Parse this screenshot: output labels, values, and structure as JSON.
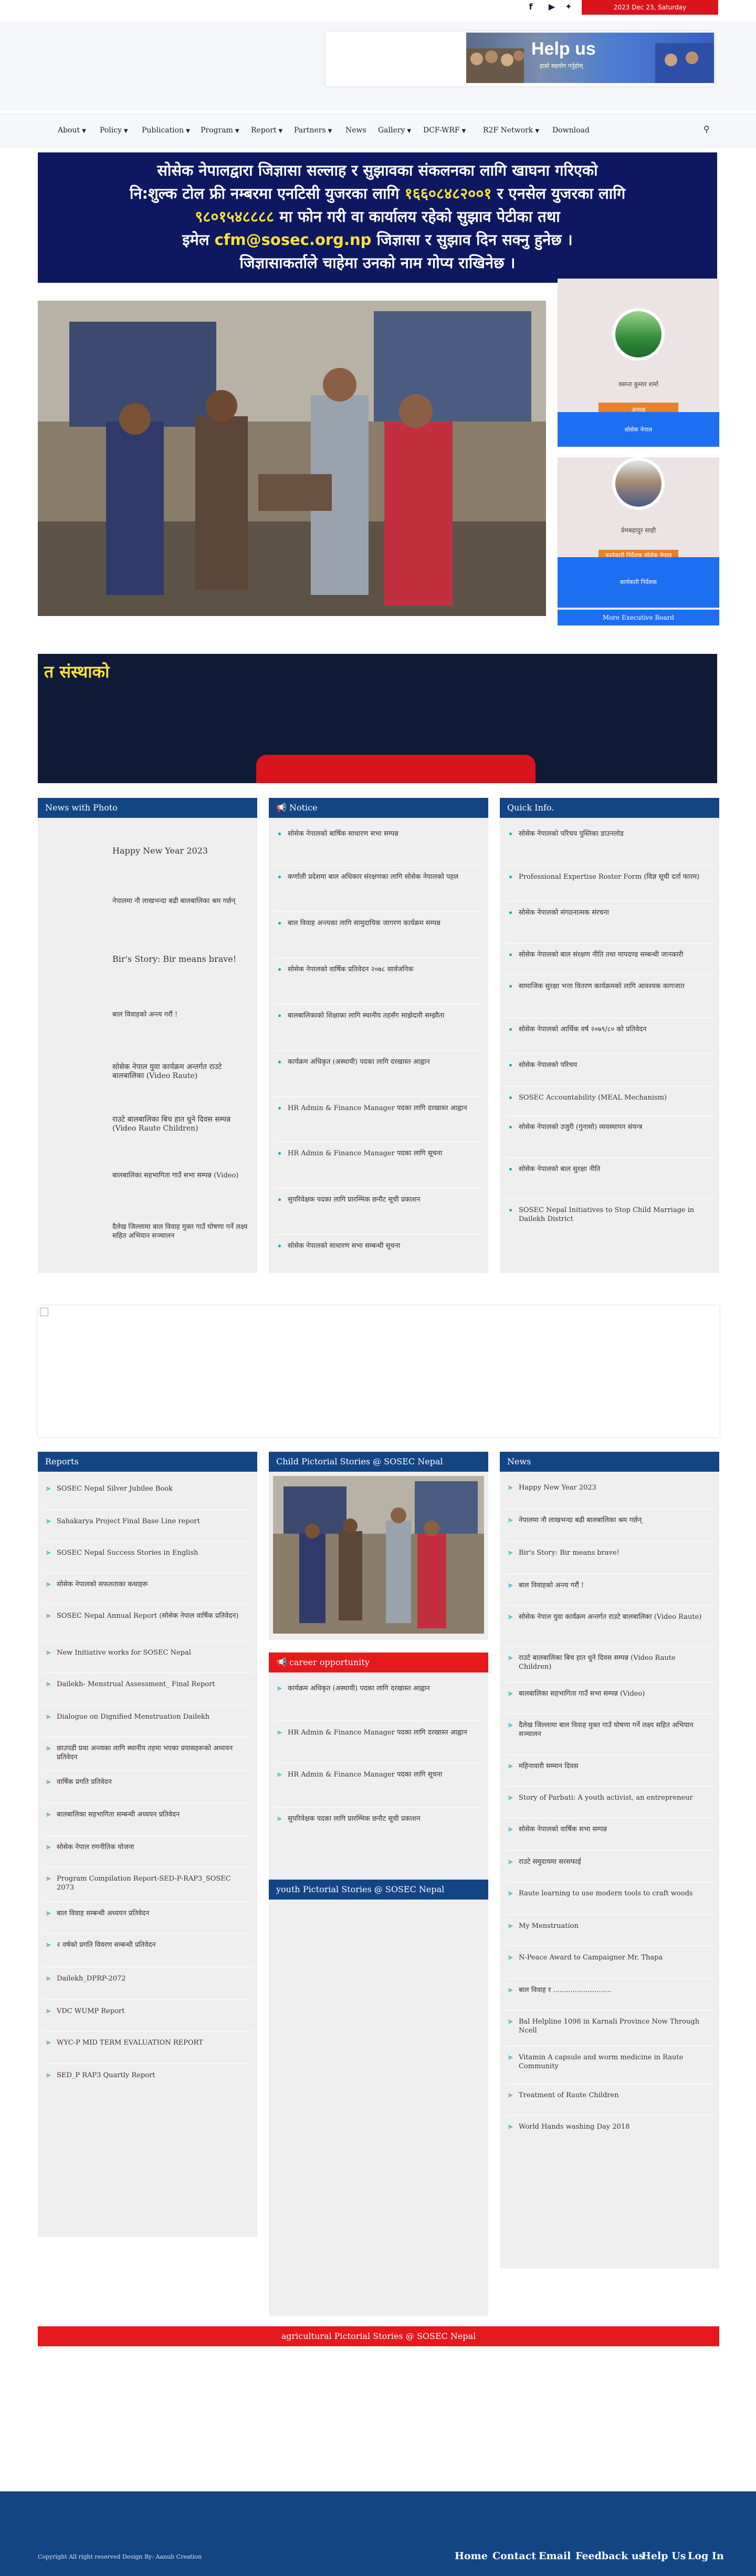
{
  "topbar": {
    "date": "2023 Dec 23, Saturday",
    "icons": [
      "facebook-icon",
      "youtube-icon",
      "twitter-icon"
    ]
  },
  "help_banner": {
    "title": "Help us",
    "subtitle": "हाम्रो सहयोग गर्नुहोस्"
  },
  "nav": {
    "items": [
      {
        "label": "About",
        "dropdown": true
      },
      {
        "label": "Policy",
        "dropdown": true
      },
      {
        "label": "Publication",
        "dropdown": true
      },
      {
        "label": "Program",
        "dropdown": true
      },
      {
        "label": "Report",
        "dropdown": true
      },
      {
        "label": "Partners",
        "dropdown": true
      },
      {
        "label": "News",
        "dropdown": false
      },
      {
        "label": "Gallery",
        "dropdown": true
      },
      {
        "label": "DCF-WRF",
        "dropdown": true
      },
      {
        "label": "R2F Network",
        "dropdown": true
      },
      {
        "label": "Download",
        "dropdown": false
      }
    ]
  },
  "notice_banner": {
    "line1": "सोसेक नेपालद्वारा जिज्ञासा सल्लाह र सुझावका संकलनका लागि खाघना गरिएको",
    "line2a": "नि:शुल्क टोल फ्री नम्बरमा एनटिसी युजरका लागि",
    "line2b": "१६६०८४८२००१",
    "line2c": "र एनसेल युजरका लागि",
    "line3a": "९८०१५४८८८८",
    "line3b": "मा फोन गरी वा कार्यालय रहेको सुझाव पेटीका तथा",
    "line4a": "इमेल",
    "line4b": "cfm@sosec.org.np",
    "line4c": "जिज्ञासा र सुझाव दिन सक्नु हुनेछ ।",
    "line5": "जिज्ञासाकर्ताले चाहेमा उनको नाम गोप्य राखिनेछ ।"
  },
  "executives": [
    {
      "name": "वसन्त कुमार शर्मा",
      "role": "अध्यक्ष",
      "bar": "सोसेक नेपाल"
    },
    {
      "name": "प्रेमबहादुर साही",
      "role": "कार्यकारी निर्देशक सोसेक नेपाल",
      "bar": "कार्यकारी निर्देशक"
    }
  ],
  "more_board": "More Executive Board",
  "dark_slider": {
    "title": "त संस्थाको"
  },
  "news_photo": {
    "title": "News with Photo",
    "items": [
      "Happy New Year 2023",
      "नेपालमा नौ लाखभन्दा बढी बालबालिका श्रम गर्छन्",
      "Bir's Story: Bir means brave!",
      "बाल विवाहको अन्त्य गरौं !",
      "सोसेक नेपाल युवा कार्यक्रम अन्तर्गत राउटे बालबालिका (Video Raute)",
      "राउटे बालबालिका बिच हात धुने दिवस सम्पन्न (Video Raute Children)",
      "बालबालिका सहभागिता गाउँ सभा सम्पन्न (Video)",
      "दैलेख जिल्लामा बाल विवाह मुक्त गाउँ घोषणा गर्ने लक्ष्य सहित अभियान सञ्चालन"
    ]
  },
  "notice": {
    "title": "Notice",
    "items": [
      "सोसेक नेपालको बार्षिक साधारण सभा सम्पन्न",
      "कर्णाली प्रदेशमा बाल अधिकार संरक्षणका लागि सोसेक नेपालको पहल",
      "बाल विवाह अन्त्यका लागि सामुदायिक जागरण कार्यक्रम सम्पन्न",
      "सोसेक नेपालको वार्षिक प्रतिवेदन २०७८ सार्वजनिक",
      "बालबालिकाको शिक्षाका लागि स्थानीय तहसँग साझेदारी सम्झौता",
      "कार्यक्रम अधिकृत (अस्थायी) पदका लागि दरखास्त आह्वान",
      "HR Admin & Finance Manager पदका लागि दरखास्त आह्वान",
      "HR Admin & Finance Manager पदका लागि सूचना",
      "सुपरिवेक्षक पदका लागि प्रारम्भिक छनौट सूची प्रकाशन",
      "सोसेक नेपालको साधारण सभा सम्बन्धी सूचना"
    ]
  },
  "quick_info": {
    "title": "Quick Info.",
    "items": [
      "सोसेक नेपालको परिचय पुस्तिका डाउनलोड",
      "Professional Expertise Roster Form (विज्ञ सूची दर्ता फारम)",
      "सोसेक नेपालको संगठनात्मक संरचना",
      "सोसेक नेपालको बाल संरक्षण नीति तथा मापदण्ड सम्बन्धी जानकारी",
      "सामाजिक सुरक्षा भत्ता वितरण कार्यक्रमको लागि आवश्यक कागजात",
      "सोसेक नेपालको आर्थिक वर्ष २०७९/८० को प्रतिवेदन",
      "सोसेक नेपालको परिचय",
      "SOSEC Accountability (MEAL Mechanism)",
      "सोसेक नेपालको उजुरी (गुनासो) व्यवस्थापन संयन्त्र",
      "सोसेक नेपालको बाल सुरक्षा नीति",
      "SOSEC Nepal Initiatives to Stop Child Marriage in Dailekh District"
    ]
  },
  "reports": {
    "title": "Reports",
    "items": [
      "SOSEC Nepal Silver Jubilee Book",
      "Sahakarya Project Final Base Line report",
      "SOSEC Nepal Success Stories in English",
      "सोसेक नेपालको सफलताका कथाहरू",
      "SOSEC Nepal Annual Report (सोसेक नेपाल वार्षिक प्रतिवेदन)",
      "New Initiative works for SOSEC Nepal",
      "Dailekh- Menstrual Assessment_ Final Report",
      "Dialogue on Dignified Menstruation Dailekh",
      "छाउपडी प्रथा अन्त्यका लागि स्थानीय तहमा भएका प्रयासहरूको अध्ययन प्रतिवेदन",
      "वार्षिक प्रगति प्रतिवेदन",
      "बालबालिका सहभागिता सम्बन्धी अध्ययन प्रतिवेदन",
      "सोसेक नेपाल रणनीतिक योजना",
      "Program Compilation Report-SED-P-RAP3_SOSEC 2073",
      "बाल विवाह सम्बन्धी अध्ययन प्रतिवेदन",
      "२ वर्षको प्रगति विवरण सम्बन्धी प्रतिवेदन",
      "Dailekh_DPRP-2072",
      "VDC WUMP Report",
      "WYC-P MID TERM EVALUATION REPORT",
      "SED_P RAP3 Quartly Report"
    ]
  },
  "child_stories": {
    "title": "Child Pictorial Stories @ SOSEC Nepal"
  },
  "career": {
    "title": "career opportunity",
    "items": [
      "कार्यक्रम अधिकृत (अस्थायी) पदका लागि दरखास्त आह्वान",
      "HR Admin & Finance Manager पदका लागि दरखास्त आह्वान",
      "HR Admin & Finance Manager पदका लागि सूचना",
      "सुपरिवेक्षक पदका लागि प्रारम्भिक छनौट सूची प्रकाशन"
    ]
  },
  "youth_stories": {
    "title": "youth Pictorial Stories @ SOSEC Nepal"
  },
  "news": {
    "title": "News",
    "items": [
      "Happy New Year 2023",
      "नेपालमा नौ लाखभन्दा बढी बालबालिका श्रम गर्छन्",
      "Bir's Story: Bir means brave!",
      "बाल विवाहको अन्त्य गरौं !",
      "सोसेक नेपाल युवा कार्यक्रम अन्तर्गत राउटे बालबालिका (Video Raute)",
      "राउटे बालबालिका बिच हात धुने दिवस सम्पन्न (Video Raute Children)",
      "बालबालिका सहभागिता गाउँ सभा सम्पन्न (Video)",
      "दैलेख जिल्लामा बाल विवाह मुक्त गाउँ घोषणा गर्ने लक्ष्य सहित अभियान सञ्चालन",
      "महिनावारी सम्मान दिवस",
      "Story of Parbati: A youth activist, an entrepreneur",
      "सोसेक नेपालको वार्षिक सभा सम्पन्न",
      "राउटे समुदायमा सरसफाई",
      "Raute learning to use modern tools to craft woods",
      "My Menstruation",
      "N-Peace Award to Campaigner Mr. Thapa",
      "बाल विवाह र ...........................",
      "Bal Helpline 1098 in Karnali Province Now Through Ncell",
      "Vitamin A capsule and worm medicine in Raute Community",
      "Treatment of Raute Children",
      "World Hands washing Day 2018"
    ]
  },
  "agri": {
    "title": "agricultural Pictorial Stories @ SOSEC Nepal"
  },
  "footer": {
    "copyright": "Copyright All right reserved Design By: Aanub Creation",
    "links": [
      "Home",
      "Contact",
      "Email",
      "Feedback us",
      "Help Us",
      "Log In"
    ]
  }
}
